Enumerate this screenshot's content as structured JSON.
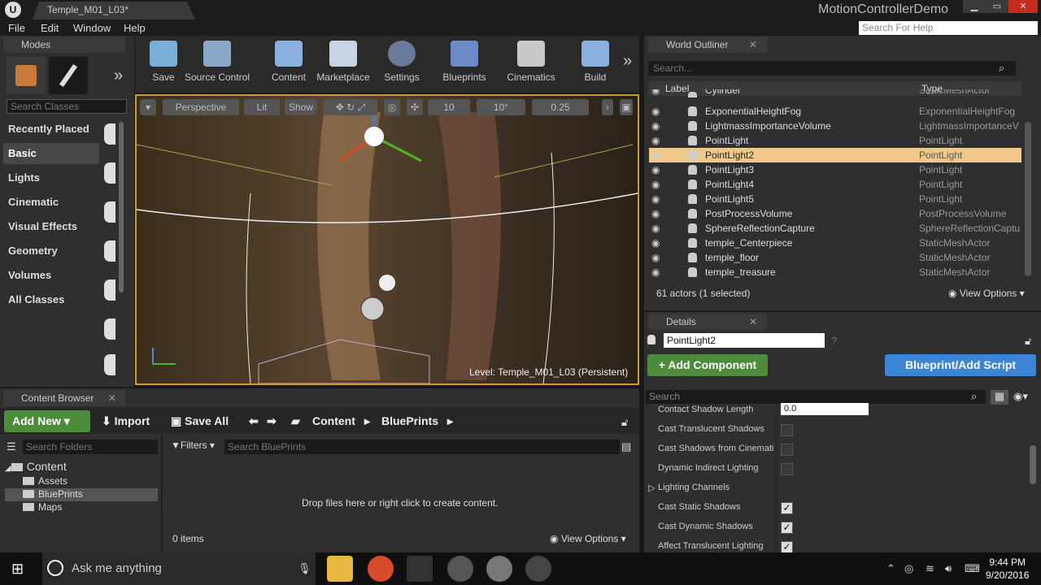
{
  "window": {
    "doc_tab": "Temple_M01_L03*",
    "project_name": "MotionControllerDemo",
    "help_search": "Search For Help",
    "btn_min": "▁",
    "btn_max": "▭",
    "btn_close": "✕"
  },
  "menu": [
    "File",
    "Edit",
    "Window",
    "Help"
  ],
  "modes": {
    "tab": "Modes",
    "search_placeholder": "Search Classes",
    "categories": [
      "Recently Placed",
      "Basic",
      "Lights",
      "Cinematic",
      "Visual Effects",
      "Geometry",
      "Volumes",
      "All Classes"
    ],
    "selected": "Basic"
  },
  "toolbar": {
    "buttons": [
      "Save",
      "Source Control",
      "Content",
      "Marketplace",
      "Settings",
      "Blueprints",
      "Cinematics",
      "Build"
    ]
  },
  "viewport": {
    "perspective": "Perspective",
    "lit": "Lit",
    "show": "Show",
    "grid_snap": "10",
    "rot_snap": "10°",
    "scale_snap": "0.25",
    "level_label": "Level:",
    "level_name": "Temple_M01_L03 (Persistent)"
  },
  "outliner": {
    "tab": "World Outliner",
    "search_placeholder": "Search...",
    "col_label": "Label",
    "col_type": "Type",
    "rows": [
      {
        "label": "Cylinder",
        "type": "StaticMeshActor"
      },
      {
        "label": "ExponentialHeightFog",
        "type": "ExponentialHeightFog"
      },
      {
        "label": "LightmassImportanceVolume",
        "type": "LightmassImportanceV"
      },
      {
        "label": "PointLight",
        "type": "PointLight"
      },
      {
        "label": "PointLight2",
        "type": "PointLight"
      },
      {
        "label": "PointLight3",
        "type": "PointLight"
      },
      {
        "label": "PointLight4",
        "type": "PointLight"
      },
      {
        "label": "PointLight5",
        "type": "PointLight"
      },
      {
        "label": "PostProcessVolume",
        "type": "PostProcessVolume"
      },
      {
        "label": "SphereReflectionCapture",
        "type": "SphereReflectionCaptu"
      },
      {
        "label": "temple_Centerpiece",
        "type": "StaticMeshActor"
      },
      {
        "label": "temple_floor",
        "type": "StaticMeshActor"
      },
      {
        "label": "temple_treasure",
        "type": "StaticMeshActor"
      }
    ],
    "selected": "PointLight2",
    "status": "61 actors (1 selected)",
    "view_options": "View Options"
  },
  "details": {
    "tab": "Details",
    "name_value": "PointLight2",
    "add_component": "+ Add Component",
    "blueprint_script": "Blueprint/Add Script",
    "search_placeholder": "Search",
    "properties": [
      {
        "label": "Contact Shadow Length",
        "value": "0.0"
      },
      {
        "label": "Cast Translucent Shadows",
        "checked": false
      },
      {
        "label": "Cast Shadows from Cinemati",
        "checked": false
      },
      {
        "label": "Dynamic Indirect Lighting",
        "checked": false
      },
      {
        "label": "Lighting Channels"
      },
      {
        "label": "Cast Static Shadows",
        "checked": true
      },
      {
        "label": "Cast Dynamic Shadows",
        "checked": true
      },
      {
        "label": "Affect Translucent Lighting",
        "checked": true
      }
    ]
  },
  "content_browser": {
    "tab": "Content Browser",
    "add_new": "Add New",
    "import": "Import",
    "save_all": "Save All",
    "crumbs": [
      "Content",
      "BluePrints"
    ],
    "folder_search": "Search Folders",
    "filters": "Filters",
    "asset_search": "Search BluePrints",
    "tree": {
      "root": "Content",
      "children": [
        "Assets",
        "BluePrints",
        "Maps"
      ],
      "selected": "BluePrints"
    },
    "drop_message": "Drop files here or right click to create content.",
    "item_count": "0 items",
    "view_options": "View Options"
  },
  "taskbar": {
    "search_placeholder": "Ask me anything",
    "time": "9:44 PM",
    "date": "9/20/2016"
  },
  "colors": {
    "accent_green": "#4d8c3a",
    "accent_blue": "#3c84d6",
    "selection": "#f0c88a",
    "viewport_border": "#c89a32"
  }
}
